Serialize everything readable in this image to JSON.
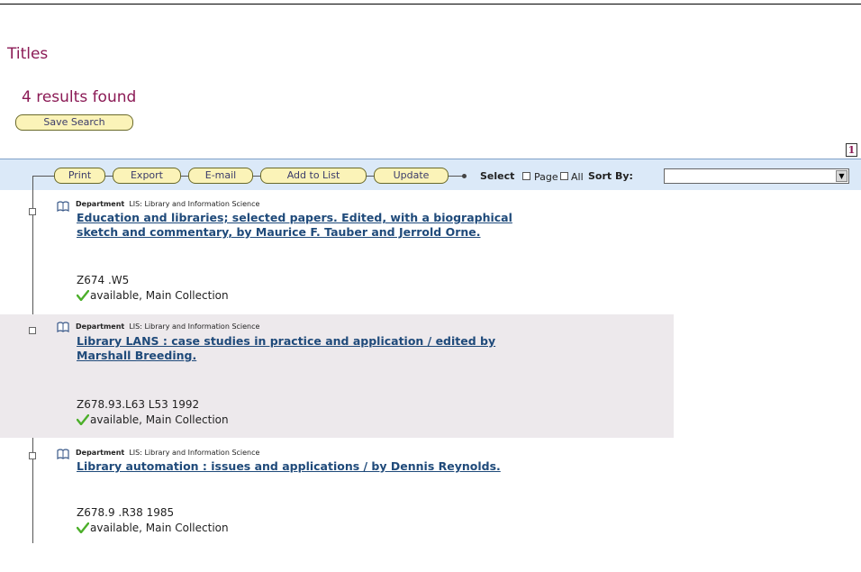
{
  "page": {
    "title": "Titles",
    "results_count": "4 results found",
    "save_search_label": "Save Search",
    "page_number": "1"
  },
  "toolbar": {
    "buttons": [
      "Print",
      "Export",
      "E-mail",
      "Add to List",
      "Update"
    ],
    "select_label": "Select",
    "page_option_label": "Page",
    "all_option_label": "All",
    "sort_label": "Sort By:",
    "sort_value": ""
  },
  "records": [
    {
      "dept_label": "Department",
      "dept_value": "LIS: Library and Information Science",
      "title_line1": "Education and libraries; selected papers. Edited, with a biographical",
      "title_line2": "sketch and commentary, by Maurice F. Tauber and Jerrold Orne.",
      "call_number": "Z674 .W5",
      "availability": "available, Main Collection"
    },
    {
      "dept_label": "Department",
      "dept_value": "LIS: Library and Information Science",
      "title_line1": "Library LANS : case studies in practice and application / edited by",
      "title_line2": "Marshall Breeding.",
      "call_number": "Z678.93.L63 L53 1992",
      "availability": "available, Main Collection"
    },
    {
      "dept_label": "Department",
      "dept_value": "LIS: Library and Information Science",
      "title_line1": "Library automation : issues and applications / by Dennis Reynolds.",
      "title_line2": "",
      "call_number": "Z678.9 .R38 1985",
      "availability": "available, Main Collection"
    }
  ],
  "colors": {
    "heading": "#8b1a55",
    "link": "#1f4a7a",
    "toolbar_bg": "#dbe9f8",
    "button_bg": "#fbf3b8",
    "shaded_row": "#ede9ec",
    "check": "#4caf2a"
  },
  "icons": {
    "record": "book-icon",
    "availability": "check-icon",
    "dropdown": "chevron-down-icon"
  }
}
